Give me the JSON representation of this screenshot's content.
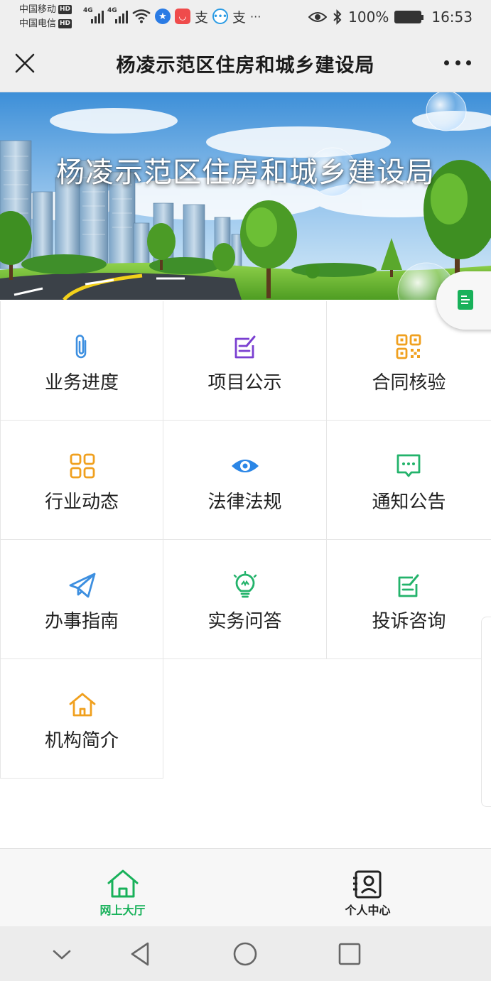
{
  "status_bar": {
    "carrier_1": "中国移动",
    "carrier_2": "中国电信",
    "hd_badge": "HD",
    "network_type": "4G",
    "battery": "100%",
    "time": "16:53",
    "overflow": "···",
    "alipay_glyph": "支"
  },
  "header": {
    "title": "杨凌示范区住房和城乡建设局"
  },
  "banner": {
    "title": "杨凌示范区住房和城乡建设局"
  },
  "menu": {
    "items": [
      {
        "label": "业务进度",
        "icon": "paperclip-icon",
        "color": "#3d8fe0"
      },
      {
        "label": "项目公示",
        "icon": "edit-note-icon",
        "color": "#7a3fd1"
      },
      {
        "label": "合同核验",
        "icon": "qr-code-icon",
        "color": "#f0a01e"
      },
      {
        "label": "行业动态",
        "icon": "grid-apps-icon",
        "color": "#f0a01e"
      },
      {
        "label": "法律法规",
        "icon": "eye-icon",
        "color": "#2b86e6"
      },
      {
        "label": "通知公告",
        "icon": "message-icon",
        "color": "#23b36b"
      },
      {
        "label": "办事指南",
        "icon": "paper-plane-icon",
        "color": "#3d8fe0"
      },
      {
        "label": "实务问答",
        "icon": "lightbulb-icon",
        "color": "#23b36b"
      },
      {
        "label": "投诉咨询",
        "icon": "edit-note-icon",
        "color": "#23b36b"
      },
      {
        "label": "机构简介",
        "icon": "home-icon",
        "color": "#f0a01e"
      }
    ]
  },
  "tabbar": {
    "tabs": [
      {
        "label": "网上大厅",
        "icon": "home-icon",
        "active": true,
        "color": "#18b15a"
      },
      {
        "label": "个人中心",
        "icon": "user-card-icon",
        "active": false,
        "color": "#222222"
      }
    ]
  }
}
